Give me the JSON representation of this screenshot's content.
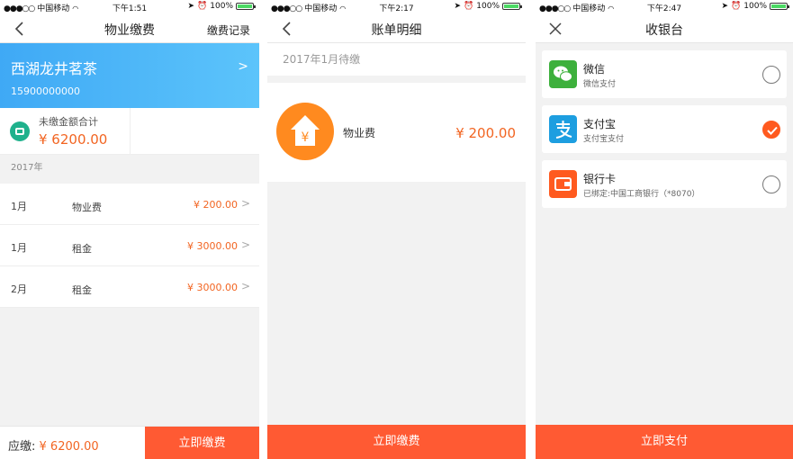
{
  "status": {
    "carrier": "中国移动",
    "battery": "100%",
    "times": [
      "下午1:51",
      "下午2:17",
      "下午2:47"
    ]
  },
  "screen1": {
    "title": "物业缴费",
    "right_link": "缴费记录",
    "house_name": "西湖龙井茗茶",
    "phone": "15900000000",
    "unpaid_label": "未缴金额合计",
    "unpaid_amount": "¥ 6200.00",
    "year": "2017年",
    "rows": [
      {
        "month": "1月",
        "item": "物业费",
        "price": "¥ 200.00"
      },
      {
        "month": "1月",
        "item": "租金",
        "price": "¥ 3000.00"
      },
      {
        "month": "2月",
        "item": "租金",
        "price": "¥ 3000.00"
      }
    ],
    "due_label": "应缴:",
    "due_amount": "¥ 6200.00",
    "pay_button": "立即缴费"
  },
  "screen2": {
    "title": "账单明细",
    "pending": "2017年1月待缴",
    "fee_name": "物业费",
    "fee_amount": "¥ 200.00",
    "house_symbol": "¥",
    "pay_button": "立即缴费"
  },
  "screen3": {
    "title": "收银台",
    "methods": [
      {
        "name": "微信",
        "sub": "微信支付",
        "icon": "wechat-icon",
        "color": "#3db03c",
        "checked": false
      },
      {
        "name": "支付宝",
        "sub": "支付宝支付",
        "icon": "alipay-icon",
        "color": "#1d9ee0",
        "checked": true
      },
      {
        "name": "银行卡",
        "sub": "已绑定:中国工商银行（*8070）",
        "icon": "bank-card-icon",
        "color": "#ff5a1f",
        "checked": false
      }
    ],
    "pay_button": "立即支付"
  },
  "colors": {
    "accent": "#ff5a33",
    "price": "#f26522",
    "header_gradient_start": "#3fa9f5",
    "header_gradient_end": "#5cc4fb"
  }
}
